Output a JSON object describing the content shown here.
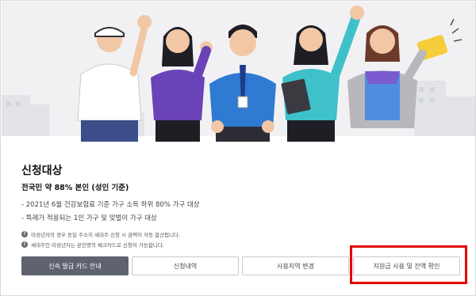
{
  "section": {
    "title": "신청대상",
    "subtitle": "전국민 약 88% 본인 (성인 기준)",
    "bullets": [
      "- 2021년 6월 건강보험료 기준 가구 소득 하위 80% 가구 대상",
      "- 특례가 적용되는 1인 가구 및 맞벌이 가구 대상"
    ],
    "notes": [
      "미성년자의 경우 동일 주소지 세대주 신청 시 금액이 자동 합산됩니다.",
      "세대주인 미성년자는 본인명의 체크카드로 신청이 가능합니다."
    ],
    "note_icon": "!"
  },
  "buttons": [
    {
      "label": "신속 발급 카드 안내",
      "style": "primary"
    },
    {
      "label": "신청내역",
      "style": "outline"
    },
    {
      "label": "사용지역 변경",
      "style": "outline"
    },
    {
      "label": "지원금 사용 및 잔액 확인",
      "style": "outline",
      "highlighted": true
    }
  ],
  "colors": {
    "primary_button": "#5f6370",
    "highlight": "#e10000",
    "hero_background": "#f1f1f4"
  },
  "hero_illustration": "people-celebrating-icon"
}
